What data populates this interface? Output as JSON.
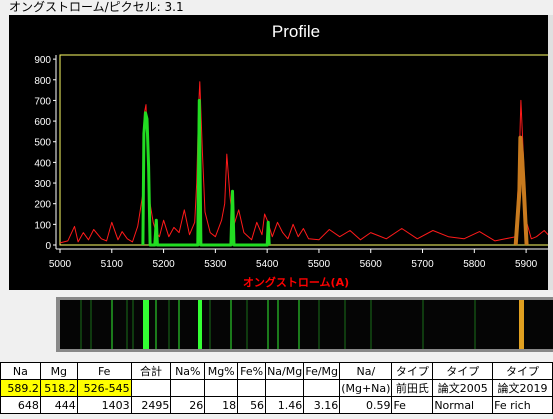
{
  "status": {
    "angstrom_per_pixel_label": "オングストローム/ピクセル: 3.1"
  },
  "chart_data": {
    "type": "line",
    "title": "Profile",
    "xlabel": "オングストローム(A)",
    "ylabel": "",
    "xlim": [
      5000,
      5950
    ],
    "ylim": [
      0,
      920
    ],
    "x_ticks": [
      "5000",
      "5100",
      "5200",
      "5300",
      "5400",
      "5500",
      "5600",
      "5700",
      "5800",
      "5900"
    ],
    "y_ticks": [
      "0",
      "100",
      "200",
      "300",
      "400",
      "500",
      "600",
      "700",
      "800",
      "900"
    ],
    "grid": false,
    "colors": {
      "background": "#000000",
      "plot_border": "#ffff66",
      "red_series": "#ff1a1a",
      "green_series": "#22dd22",
      "orange_series": "#c87a1e",
      "title": "#ffffff",
      "ticks": "#ffffff",
      "xlabel": "#ff0000"
    },
    "series": [
      {
        "color_name": "red",
        "x": [
          5000,
          5015,
          5028,
          5035,
          5045,
          5055,
          5065,
          5080,
          5090,
          5100,
          5112,
          5120,
          5130,
          5140,
          5150,
          5160,
          5163,
          5166,
          5170,
          5174,
          5180,
          5186,
          5192,
          5200,
          5210,
          5220,
          5230,
          5240,
          5250,
          5260,
          5264,
          5268,
          5270,
          5275,
          5280,
          5290,
          5300,
          5312,
          5318,
          5322,
          5328,
          5335,
          5345,
          5355,
          5370,
          5380,
          5390,
          5395,
          5400,
          5410,
          5420,
          5430,
          5440,
          5450,
          5460,
          5470,
          5480,
          5500,
          5520,
          5540,
          5560,
          5580,
          5600,
          5630,
          5660,
          5690,
          5720,
          5750,
          5780,
          5810,
          5840,
          5860,
          5880,
          5886,
          5890,
          5895,
          5900,
          5910,
          5920,
          5935,
          5950
        ],
        "y": [
          10,
          20,
          90,
          15,
          60,
          25,
          75,
          30,
          20,
          110,
          25,
          65,
          30,
          15,
          90,
          250,
          640,
          680,
          380,
          200,
          110,
          60,
          40,
          120,
          40,
          85,
          60,
          170,
          50,
          110,
          300,
          690,
          790,
          450,
          160,
          60,
          40,
          120,
          200,
          440,
          240,
          90,
          170,
          60,
          25,
          110,
          50,
          150,
          120,
          40,
          110,
          60,
          30,
          100,
          40,
          80,
          30,
          25,
          75,
          40,
          70,
          25,
          60,
          30,
          80,
          30,
          70,
          40,
          30,
          65,
          20,
          30,
          40,
          360,
          700,
          420,
          120,
          30,
          40,
          70,
          30
        ]
      },
      {
        "color_name": "green",
        "x": [
          5160,
          5162,
          5165,
          5168,
          5171,
          5174,
          5183,
          5186,
          5188,
          5266,
          5269,
          5272,
          5330,
          5333,
          5336,
          5400,
          5402,
          5404
        ],
        "y": [
          0,
          540,
          640,
          610,
          380,
          0,
          0,
          120,
          0,
          0,
          700,
          0,
          0,
          260,
          0,
          0,
          110,
          0
        ],
        "width": 3
      },
      {
        "color_name": "orange",
        "x": [
          5880,
          5887,
          5889,
          5892,
          5895,
          5901
        ],
        "y": [
          0,
          260,
          520,
          430,
          300,
          0
        ],
        "width": 4
      }
    ]
  },
  "spectrum_strip": {
    "colors": {
      "bright_green": "#33ff33",
      "dim_green": "#1b7a1b",
      "faint_green": "#0f3a0f",
      "orange": "#e0a020"
    },
    "bright_green_x": [
      5163,
      5168,
      5269
    ],
    "dim_green_x": [
      5100,
      5185,
      5230,
      5330,
      5400,
      5420,
      5460
    ],
    "faint_green_x": [
      5040,
      5060,
      5130,
      5140,
      5210,
      5290,
      5360,
      5500,
      5550,
      5600,
      5700,
      5800
    ],
    "orange_x": [
      5890
    ]
  },
  "table": {
    "header": [
      "Na",
      "Mg",
      "Fe",
      "合計",
      "Na%",
      "Mg%",
      "Fe%",
      "Na/Mg",
      "Fe/Mg",
      "Na/",
      "タイプ",
      "タイプ",
      "タイプ"
    ],
    "row_wavelengths": [
      "589.2",
      "518.2",
      "526-545",
      "",
      "",
      "",
      "",
      "",
      "",
      "(Mg+Na)",
      "前田氏",
      "論文2005",
      "論文2019"
    ],
    "row_values": [
      "648",
      "444",
      "1403",
      "2495",
      "26",
      "18",
      "56",
      "1.46",
      "3.16",
      "0.59",
      "Fe",
      "Normal",
      "Fe rich"
    ]
  }
}
